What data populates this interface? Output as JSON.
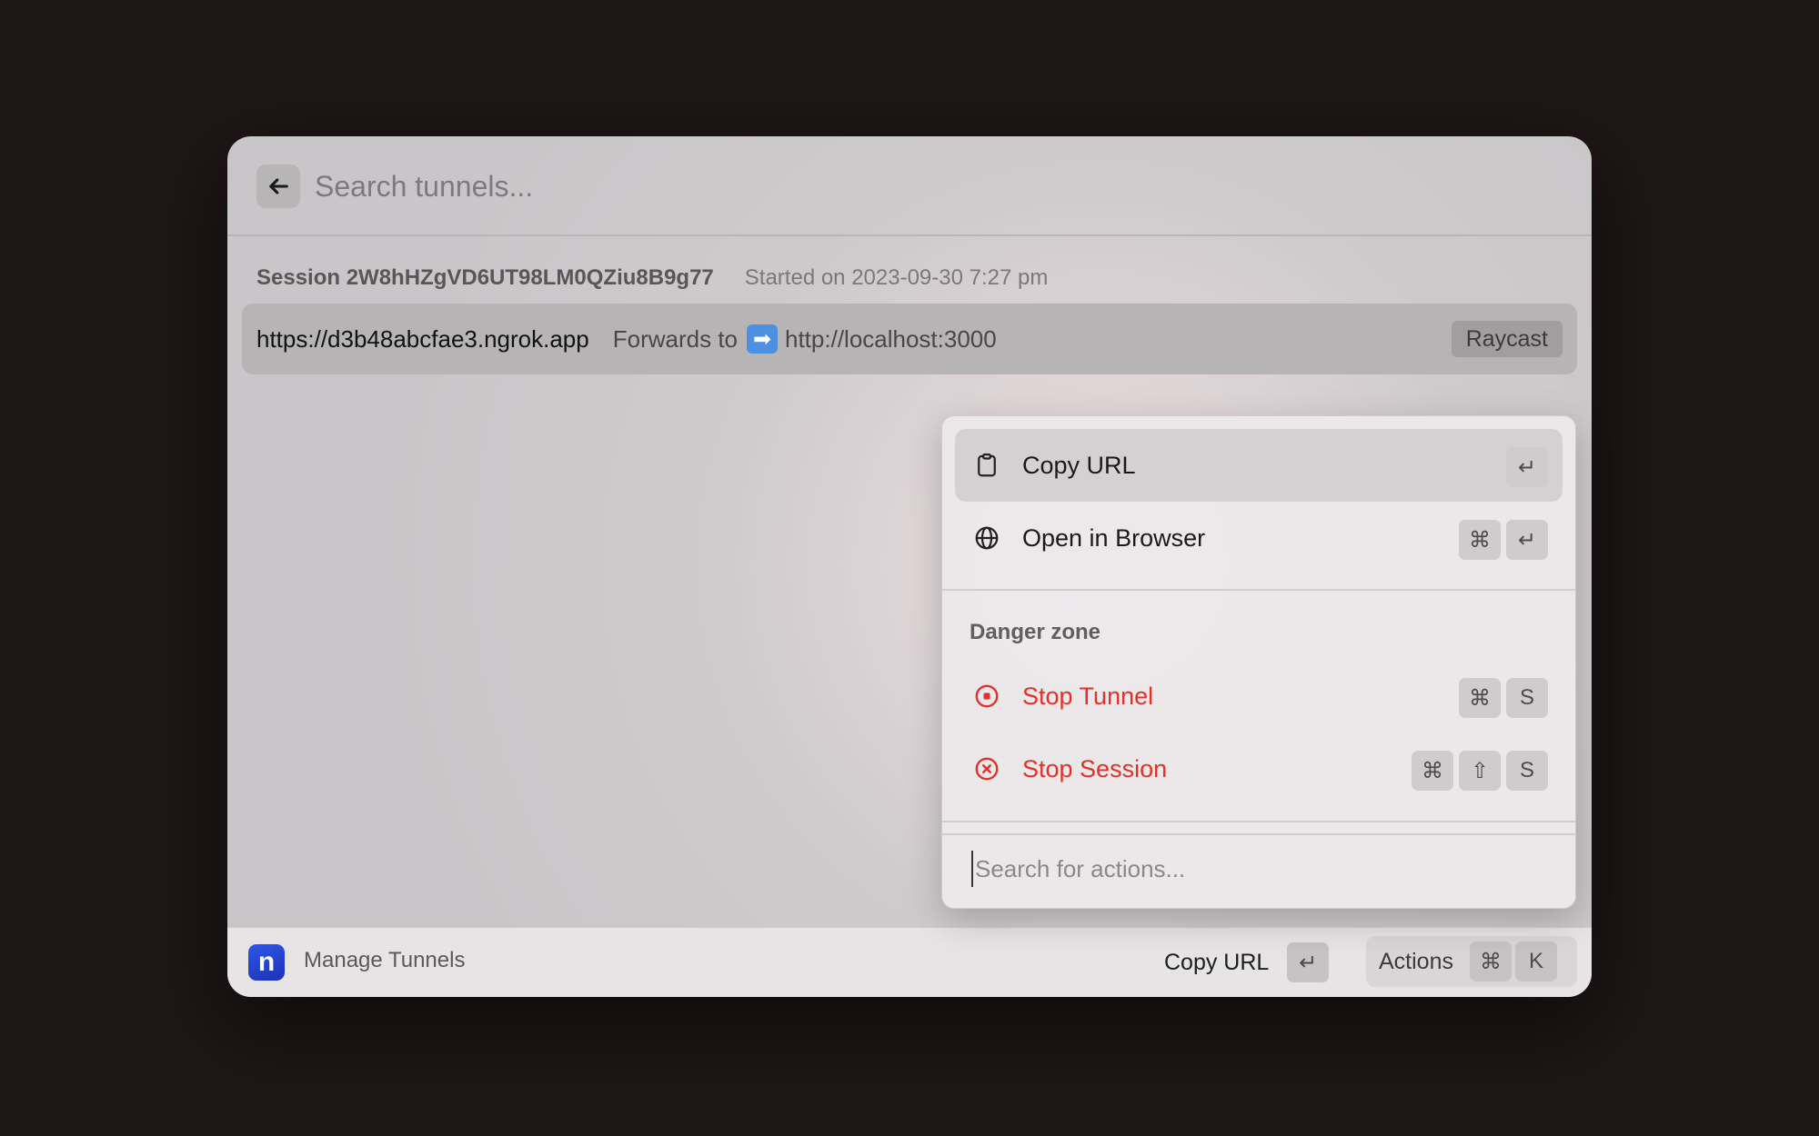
{
  "search": {
    "placeholder": "Search tunnels..."
  },
  "section": {
    "title": "Session 2W8hHZgVD6UT98LM0QZiu8B9g77",
    "subtitle": "Started on 2023-09-30 7:27 pm"
  },
  "tunnel": {
    "url": "https://d3b48abcfae3.ngrok.app",
    "forwards_label": "Forwards to",
    "forwards_emoji": "➡",
    "target": "http://localhost:3000",
    "tag": "Raycast"
  },
  "actions_panel": {
    "items": [
      {
        "label": "Copy URL",
        "icon": "clipboard-icon",
        "keys": [
          "↵"
        ]
      },
      {
        "label": "Open in Browser",
        "icon": "globe-icon",
        "keys": [
          "⌘",
          "↵"
        ]
      }
    ],
    "danger_section_title": "Danger zone",
    "danger_items": [
      {
        "label": "Stop Tunnel",
        "icon": "stop-circle-icon",
        "keys": [
          "⌘",
          "S"
        ]
      },
      {
        "label": "Stop Session",
        "icon": "x-circle-icon",
        "keys": [
          "⌘",
          "⇧",
          "S"
        ]
      }
    ],
    "search_placeholder": "Search for actions..."
  },
  "footer": {
    "app_logo_letter": "n",
    "app_name": "Manage Tunnels",
    "primary_action": "Copy URL",
    "primary_key": "↵",
    "actions_label": "Actions",
    "actions_keys": [
      "⌘",
      "K"
    ]
  },
  "colors": {
    "danger": "#e0312b",
    "logo": "#2f56e8"
  }
}
